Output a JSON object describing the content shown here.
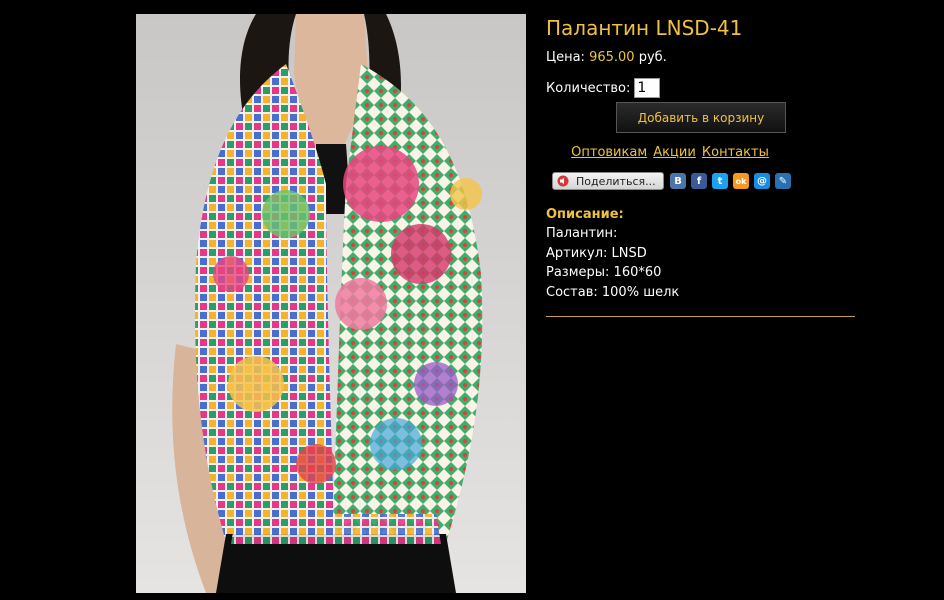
{
  "product": {
    "title": "Палантин LNSD-41",
    "price_label": "Цена:",
    "price_value": "965.00",
    "price_currency": "руб.",
    "quantity_label": "Количество:",
    "quantity_value": "1",
    "add_to_cart_label": "Добавить в корзину"
  },
  "links": {
    "wholesale": "Оптовикам",
    "promos": "Акции",
    "contacts": "Контакты"
  },
  "share": {
    "button_label": "Поделиться...",
    "networks": [
      {
        "name": "vkontakte",
        "glyph": "В",
        "color": "#4a76a8"
      },
      {
        "name": "facebook",
        "glyph": "f",
        "color": "#3b5998"
      },
      {
        "name": "twitter",
        "glyph": "t",
        "color": "#1da1f2"
      },
      {
        "name": "odnoklassniki",
        "glyph": "ok",
        "color": "#f59a1e"
      },
      {
        "name": "mail-ru",
        "glyph": "@",
        "color": "#168de2"
      },
      {
        "name": "livejournal",
        "glyph": "✎",
        "color": "#2a6fb0"
      }
    ]
  },
  "description": {
    "heading": "Описание:",
    "lines": [
      "Палантин:",
      "Артикул: LNSD",
      "Размеры: 160*60",
      "Состав: 100% шелк"
    ]
  },
  "colors": {
    "accent": "#f0c040",
    "background": "#000000",
    "text": "#ffffff"
  }
}
